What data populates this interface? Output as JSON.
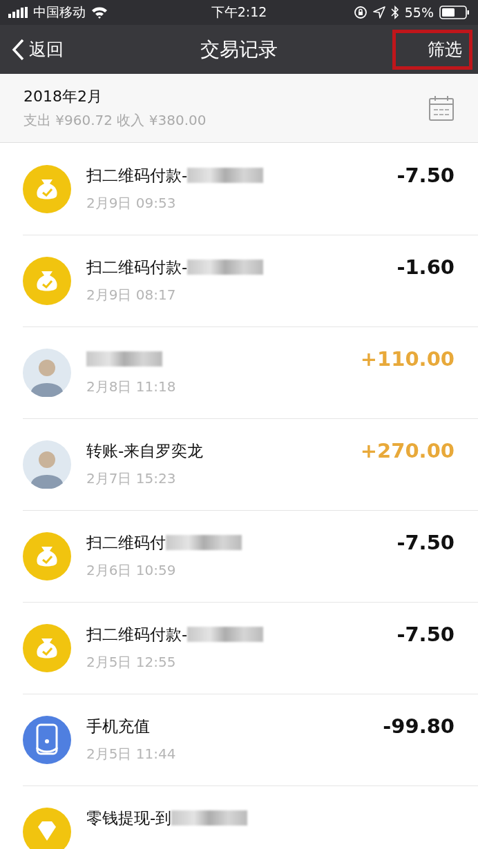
{
  "status_bar": {
    "carrier": "中国移动",
    "time": "下午2:12",
    "battery": "55%"
  },
  "nav": {
    "back": "返回",
    "title": "交易记录",
    "filter": {
      "label": "筛选",
      "highlighted": true
    }
  },
  "month": {
    "title": "2018年2月",
    "summary": "支出 ¥960.72 收入 ¥380.00"
  },
  "transactions": [
    {
      "kind": "pay",
      "title": "扫二维码付款-",
      "redacted": true,
      "time": "2月9日 09:53",
      "amount": "-7.50",
      "income": false
    },
    {
      "kind": "pay",
      "title": "扫二维码付款-",
      "redacted": true,
      "time": "2月9日 08:17",
      "amount": "-1.60",
      "income": false
    },
    {
      "kind": "avatar",
      "redacted": true,
      "time": "2月8日 11:18",
      "amount": "+110.00",
      "income": true
    },
    {
      "kind": "avatar",
      "title": "转账-来自罗奕龙",
      "redacted": false,
      "time": "2月7日 15:23",
      "amount": "+270.00",
      "income": true
    },
    {
      "kind": "pay",
      "title": "扫二维码付",
      "redacted": true,
      "time": "2月6日 10:59",
      "amount": "-7.50",
      "income": false
    },
    {
      "kind": "pay",
      "title": "扫二维码付款-",
      "redacted": true,
      "time": "2月5日 12:55",
      "amount": "-7.50",
      "income": false
    },
    {
      "kind": "phone",
      "title": "手机充值",
      "redacted": false,
      "time": "2月5日 11:44",
      "amount": "-99.80",
      "income": false
    },
    {
      "kind": "diamond",
      "title": "零钱提现-到",
      "redacted": true
    }
  ]
}
